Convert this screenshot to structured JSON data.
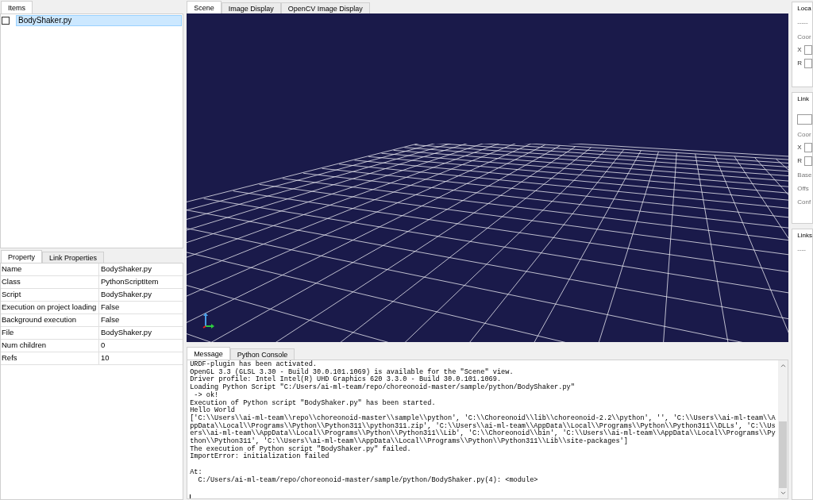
{
  "items_panel": {
    "tabs": [
      {
        "label": "Items",
        "selected": true
      }
    ],
    "items": [
      {
        "label": "BodyShaker.py",
        "checked": false,
        "selected": true
      }
    ]
  },
  "property_panel": {
    "tabs": [
      {
        "label": "Property",
        "selected": true
      },
      {
        "label": "Link Properties",
        "selected": false
      }
    ],
    "rows": [
      {
        "name": "Name",
        "value": "BodyShaker.py"
      },
      {
        "name": "Class",
        "value": "PythonScriptItem"
      },
      {
        "name": "Script",
        "value": "BodyShaker.py"
      },
      {
        "name": "Execution on project loading",
        "value": "False"
      },
      {
        "name": "Background execution",
        "value": "False"
      },
      {
        "name": "File",
        "value": "BodyShaker.py"
      },
      {
        "name": "Num children",
        "value": "0"
      },
      {
        "name": "Refs",
        "value": "10"
      }
    ]
  },
  "view_tabs": [
    {
      "label": "Scene",
      "selected": true
    },
    {
      "label": "Image Display",
      "selected": false
    },
    {
      "label": "OpenCV Image Display",
      "selected": false
    }
  ],
  "message_panel": {
    "tabs": [
      {
        "label": "Message",
        "selected": true
      },
      {
        "label": "Python Console",
        "selected": false
      }
    ],
    "lines": [
      {
        "text": "URDF-plugin has been activated.",
        "gap_before": false
      },
      {
        "text": "OpenGL 3.3 (GLSL 3.30 - Build 30.0.101.1069) is available for the \"Scene\" view.",
        "gap_before": false
      },
      {
        "text": "Driver profile: Intel Intel(R) UHD Graphics 620 3.3.0 - Build 30.0.101.1069.",
        "gap_before": false
      },
      {
        "text": "Loading Python Script \"C:/Users/ai-ml-team/repo/choreonoid-master/sample/python/BodyShaker.py\"",
        "gap_before": false
      },
      {
        "text": " -> ok!",
        "gap_before": false
      },
      {
        "text": "Execution of Python script \"BodyShaker.py\" has been started.",
        "gap_before": false
      },
      {
        "text": "Hello World",
        "gap_before": false
      },
      {
        "text": "['C:\\\\Users\\\\ai-ml-team\\\\repo\\\\choreonoid-master\\\\sample\\\\python', 'C:\\\\Choreonoid\\\\lib\\\\choreonoid-2.2\\\\python', '', 'C:\\\\Users\\\\ai-ml-team\\\\AppData\\\\Local\\\\Programs\\\\Python\\\\Python311\\\\python311.zip', 'C:\\\\Users\\\\ai-ml-team\\\\AppData\\\\Local\\\\Programs\\\\Python\\\\Python311\\\\DLLs', 'C:\\\\Users\\\\ai-ml-team\\\\AppData\\\\Local\\\\Programs\\\\Python\\\\Python311\\\\Lib', 'C:\\\\Choreonoid\\\\bin', 'C:\\\\Users\\\\ai-ml-team\\\\AppData\\\\Local\\\\Programs\\\\Python\\\\Python311', 'C:\\\\Users\\\\ai-ml-team\\\\AppData\\\\Local\\\\Programs\\\\Python\\\\Python311\\\\Lib\\\\site-packages']",
        "gap_before": false
      },
      {
        "text": "The execution of Python script \"BodyShaker.py\" failed.",
        "gap_before": false
      },
      {
        "text": "ImportError: initialization failed",
        "gap_before": false
      },
      {
        "text": "At:",
        "gap_before": true
      },
      {
        "text": "  C:/Users/ai-ml-team/repo/choreonoid-master/sample/python/BodyShaker.py(4): <module>",
        "gap_before": false
      }
    ]
  },
  "right_panels": [
    {
      "title": "Loca",
      "texts": [
        "-----",
        "Coor"
      ],
      "fields": [
        "X",
        "R"
      ],
      "has_input": false
    },
    {
      "title": "Link",
      "texts": [
        "Coor"
      ],
      "fields": [
        "X",
        "R"
      ],
      "has_input": true,
      "after": [
        "Base",
        "Offs",
        "Conf"
      ]
    },
    {
      "title": "Links",
      "texts": [
        "----"
      ],
      "has_input": false
    }
  ]
}
